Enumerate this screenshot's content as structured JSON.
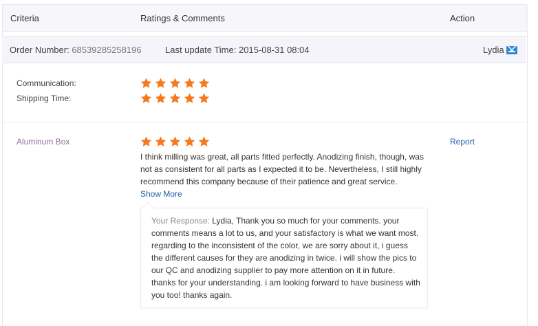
{
  "header": {
    "criteria": "Criteria",
    "ratings": "Ratings & Comments",
    "action": "Action"
  },
  "order": {
    "number_label": "Order Number:",
    "number_value": "68539285258196",
    "update_label": "Last update Time:",
    "update_value": "2015-08-31 08:04",
    "contact_name": "Lydia",
    "contact_icon": "mail-icon"
  },
  "ratings": [
    {
      "label": "Communication:",
      "stars": 5
    },
    {
      "label": "Shipping Time:",
      "stars": 5
    }
  ],
  "product": {
    "name": "Aluminum Box",
    "stars": 5,
    "report": "Report",
    "comment": "I think milling was great, all parts fitted perfectly. Anodizing finish, though, was not as consistent for all parts as I expected it to be. Nevertheless, I still highly recommend this company because of their patience and great service.",
    "show_more": "Show More",
    "response_label": "Your Response:",
    "response_text": "Lydia, Thank you so much for your comments. your comments means a lot to us, and your satisfactory is what we want most. regarding to the inconsistent of the color, we are sorry about it, i guess the different causes for they are anodizing in twice. i will show the pics to our QC and anodizing supplier to pay more attention on it in future. thanks for your understanding. i am looking forward to have business with you too! thanks again."
  },
  "colors": {
    "star": "#f47a1f",
    "link": "#1e5fa7",
    "product": "#8a6e9b"
  }
}
